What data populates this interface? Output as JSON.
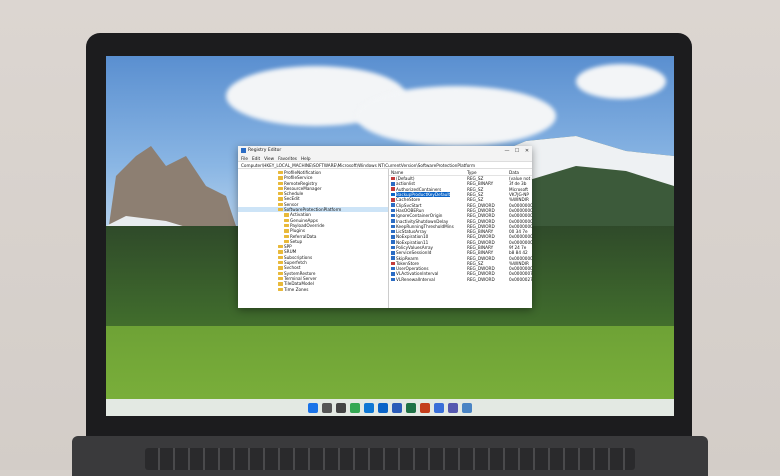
{
  "window": {
    "title": "Registry Editor",
    "controls": {
      "minimize": "—",
      "maximize": "☐",
      "close": "✕"
    },
    "menu": [
      "File",
      "Edit",
      "View",
      "Favorites",
      "Help"
    ],
    "address": "Computer\\HKEY_LOCAL_MACHINE\\SOFTWARE\\Microsoft\\Windows NT\\CurrentVersion\\SoftwareProtectionPlatform"
  },
  "tree": {
    "items": [
      {
        "label": "ProfileNotification",
        "level": 0
      },
      {
        "label": "ProfileService",
        "level": 0
      },
      {
        "label": "RemoteRegistry",
        "level": 0
      },
      {
        "label": "ResourceManager",
        "level": 0
      },
      {
        "label": "Schedule",
        "level": 0
      },
      {
        "label": "SecEdit",
        "level": 0
      },
      {
        "label": "Sensor",
        "level": 0
      },
      {
        "label": "SoftwareProtectionPlatform",
        "level": 0,
        "selected": true
      },
      {
        "label": "Activation",
        "level": 1
      },
      {
        "label": "GenuineApps",
        "level": 1
      },
      {
        "label": "PayloadOverride",
        "level": 1
      },
      {
        "label": "Plugins",
        "level": 1
      },
      {
        "label": "ReferralData",
        "level": 1
      },
      {
        "label": "Setup",
        "level": 1
      },
      {
        "label": "SPP",
        "level": 0
      },
      {
        "label": "SRUM",
        "level": 0
      },
      {
        "label": "Subscriptions",
        "level": 0
      },
      {
        "label": "Superfetch",
        "level": 0
      },
      {
        "label": "Svchost",
        "level": 0
      },
      {
        "label": "SystemRestore",
        "level": 0
      },
      {
        "label": "Terminal Server",
        "level": 0
      },
      {
        "label": "TileDataModel",
        "level": 0
      },
      {
        "label": "Time Zones",
        "level": 0
      }
    ]
  },
  "values": {
    "headers": {
      "name": "Name",
      "type": "Type",
      "data": "Data"
    },
    "rows": [
      {
        "name": "(Default)",
        "type": "REG_SZ",
        "data": "(value not set)",
        "icon": "sz"
      },
      {
        "name": "actionlist",
        "type": "REG_BINARY",
        "data": "3f de 3b",
        "icon": "bin"
      },
      {
        "name": "AuthorizedContainers",
        "type": "REG_SZ",
        "data": "Microsoft",
        "icon": "sz"
      },
      {
        "name": "BackupProductKeyDefault",
        "type": "REG_SZ",
        "data": "VK7JG-NP",
        "icon": "sz",
        "selected": true
      },
      {
        "name": "CacheStore",
        "type": "REG_SZ",
        "data": "%WINDIR",
        "icon": "sz"
      },
      {
        "name": "ClipSvcStart",
        "type": "REG_DWORD",
        "data": "0x0000000",
        "icon": "bin"
      },
      {
        "name": "HasOOBERun",
        "type": "REG_DWORD",
        "data": "0x0000000",
        "icon": "bin"
      },
      {
        "name": "IgnoreContainerOrigin",
        "type": "REG_DWORD",
        "data": "0x0000000",
        "icon": "bin"
      },
      {
        "name": "InactivityShutdownDelay",
        "type": "REG_DWORD",
        "data": "0x0000000",
        "icon": "bin"
      },
      {
        "name": "KeepRunningThresholdMins",
        "type": "REG_DWORD",
        "data": "0x0000000",
        "icon": "bin"
      },
      {
        "name": "LicStatusArray",
        "type": "REG_BINARY",
        "data": "00 34 7e",
        "icon": "bin"
      },
      {
        "name": "NoExpiration10",
        "type": "REG_DWORD",
        "data": "0x0000000",
        "icon": "bin"
      },
      {
        "name": "NoExpiration11",
        "type": "REG_DWORD",
        "data": "0x0000000",
        "icon": "bin"
      },
      {
        "name": "PolicyValuesArray",
        "type": "REG_BINARY",
        "data": "9f 24 7e",
        "icon": "bin"
      },
      {
        "name": "ServiceSessionId",
        "type": "REG_BINARY",
        "data": "b8 84 42",
        "icon": "bin"
      },
      {
        "name": "SkipRearm",
        "type": "REG_DWORD",
        "data": "0x0000000",
        "icon": "bin"
      },
      {
        "name": "TokenStore",
        "type": "REG_SZ",
        "data": "%WINDIR",
        "icon": "sz"
      },
      {
        "name": "UserOperations",
        "type": "REG_DWORD",
        "data": "0x0000000",
        "icon": "bin"
      },
      {
        "name": "VLActivationInterval",
        "type": "REG_DWORD",
        "data": "0x0000007",
        "icon": "bin"
      },
      {
        "name": "VLRenewalInterval",
        "type": "REG_DWORD",
        "data": "0x0000027",
        "icon": "bin"
      }
    ]
  },
  "taskbar": {
    "icons": [
      "windows-start-icon",
      "search-icon",
      "task-view-icon",
      "chrome-icon",
      "edge-icon",
      "outlook-icon",
      "word-icon",
      "excel-icon",
      "powerpoint-icon",
      "store-icon",
      "teams-icon",
      "settings-icon"
    ],
    "colors": [
      "#1a73e8",
      "#555555",
      "#444444",
      "#34a853",
      "#0f78d4",
      "#0a64c8",
      "#2b5cb8",
      "#1e7145",
      "#c43e1c",
      "#3a6fd8",
      "#5558af",
      "#4a84c4"
    ]
  }
}
